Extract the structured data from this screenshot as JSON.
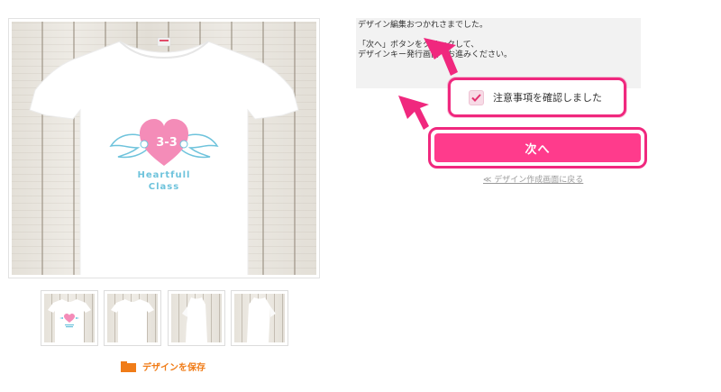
{
  "preview": {
    "print": {
      "number": "3-3",
      "line1": "Heartfull",
      "line2": "Class"
    },
    "thumbnails": [
      {
        "view": "front-with-print"
      },
      {
        "view": "front"
      },
      {
        "view": "side"
      },
      {
        "view": "side-back"
      }
    ],
    "save_label": "デザインを保存"
  },
  "info": {
    "line1": "デザイン編集おつかれさまでした。",
    "line2": "「次へ」ボタンをクリックして、",
    "line3": "デザインキー発行画面へお進みください。"
  },
  "confirm": {
    "label": "注意事項を確認しました",
    "checked": true
  },
  "next_label": "次へ",
  "back_label": "≪ デザイン作成画面に戻る",
  "colors": {
    "accent_pink": "#f0287e",
    "button_pink": "#ff3b8c",
    "heart_pink": "#f48cb8",
    "wing_blue": "#6ec3dc",
    "save_orange": "#f07c18"
  }
}
